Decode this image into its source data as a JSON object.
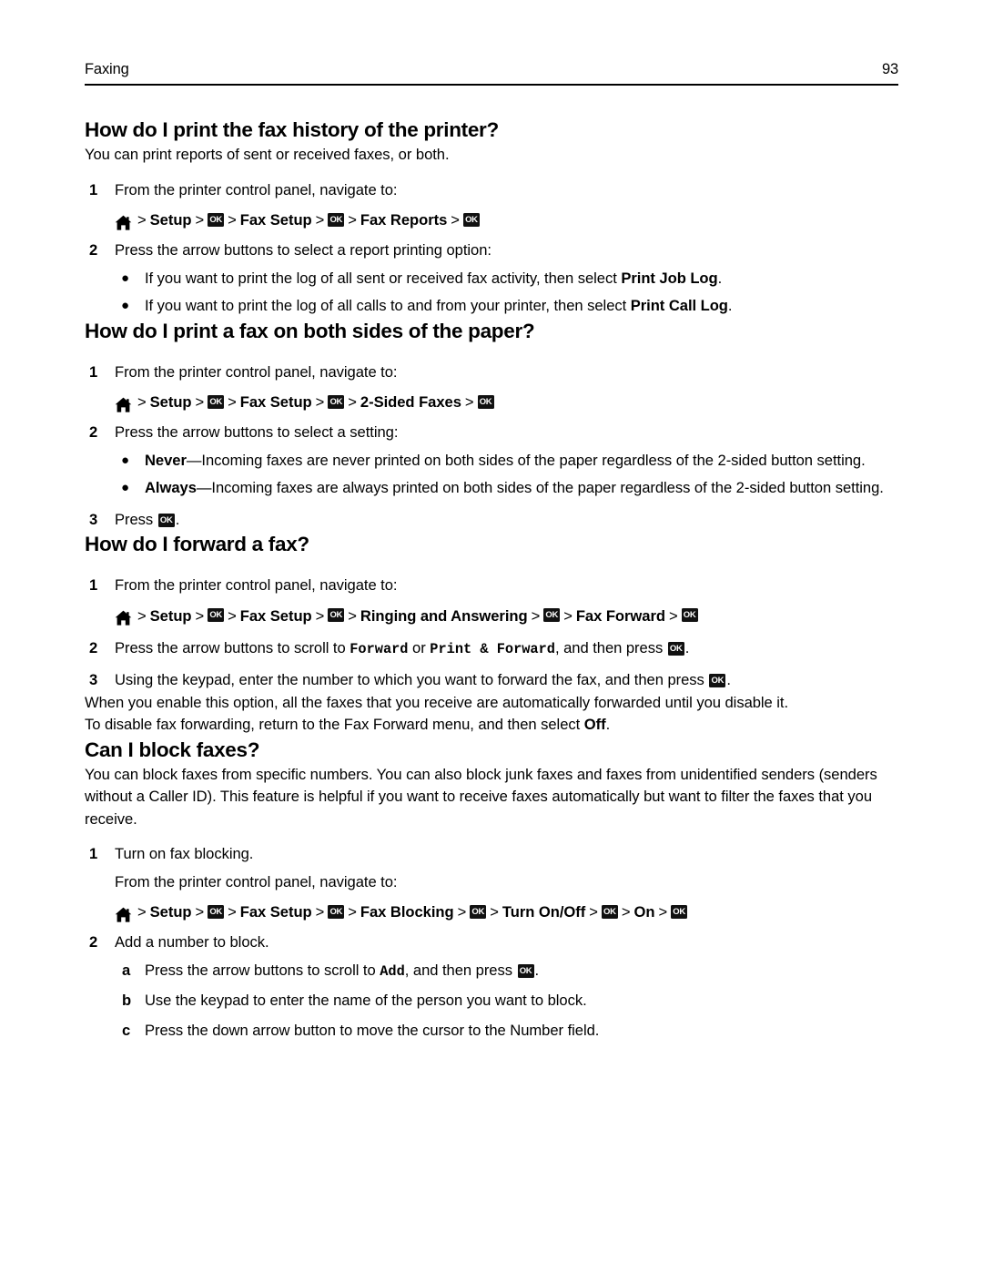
{
  "header": {
    "chapter": "Faxing",
    "page_number": "93"
  },
  "icons": {
    "home": "home-icon",
    "ok": "OK"
  },
  "sections": [
    {
      "title": "How do I print the fax history of the printer?",
      "intro": "You can print reports of sent or received faxes, or both.",
      "step1_num": "1",
      "step1_text": "From the printer control panel, navigate to:",
      "navpath": [
        "Setup",
        "Fax Setup",
        "Fax Reports"
      ],
      "step2_num": "2",
      "step2_text": "Press the arrow buttons to select a report printing option:",
      "bullets": [
        {
          "pre": "If you want to print the log of all sent or received fax activity, then select ",
          "bold": "Print Job Log",
          "post": "."
        },
        {
          "pre": "If you want to print the log of all calls to and from your printer, then select ",
          "bold": "Print Call Log",
          "post": "."
        }
      ]
    },
    {
      "title": "How do I print a fax on both sides of the paper?",
      "step1_num": "1",
      "step1_text": "From the printer control panel, navigate to:",
      "navpath": [
        "Setup",
        "Fax Setup",
        "2-Sided Faxes"
      ],
      "step2_num": "2",
      "step2_text": "Press the arrow buttons to select a setting:",
      "bullets": [
        {
          "bold": "Never",
          "post": "—Incoming faxes are never printed on both sides of the paper regardless of the 2-sided button setting."
        },
        {
          "bold": "Always",
          "post": "—Incoming faxes are always printed on both sides of the paper regardless of the 2-sided button setting."
        }
      ],
      "step3_num": "3",
      "step3_pre": "Press ",
      "step3_post": "."
    },
    {
      "title": "How do I forward a fax?",
      "step1_num": "1",
      "step1_text": "From the printer control panel, navigate to:",
      "navpath": [
        "Setup",
        "Fax Setup",
        "Ringing and Answering",
        "Fax Forward"
      ],
      "step2_num": "2",
      "step2_pre": "Press the arrow buttons to scroll to ",
      "step2_mono1": "Forward",
      "step2_mid": " or ",
      "step2_mono2": "Print & Forward",
      "step2_post": ", and then press ",
      "step2_end": ".",
      "step3_num": "3",
      "step3_pre": "Using the keypad, enter the number to which you want to forward the fax, and then press ",
      "step3_end": ".",
      "para1": "When you enable this option, all the faxes that you receive are automatically forwarded until you disable it.",
      "para2_pre": "To disable fax forwarding, return to the Fax Forward menu, and then select ",
      "para2_bold": "Off",
      "para2_post": "."
    },
    {
      "title": "Can I block faxes?",
      "intro": "You can block faxes from specific numbers. You can also block junk faxes and faxes from unidentified senders (senders without a Caller ID). This feature is helpful if you want to receive faxes automatically but want to filter the faxes that you receive.",
      "step1_num": "1",
      "step1_text": "Turn on fax blocking.",
      "step1_sub": "From the printer control panel, navigate to:",
      "navpath": [
        "Setup",
        "Fax Setup",
        "Fax Blocking",
        "Turn On/Off",
        "On"
      ],
      "step2_num": "2",
      "step2_text": "Add a number to block.",
      "substeps": [
        {
          "num": "a",
          "pre": "Press the arrow buttons to scroll to ",
          "mono": "Add",
          "post": ", and then press ",
          "end": "."
        },
        {
          "num": "b",
          "pre": "Use the keypad to enter the name of the person you want to block."
        },
        {
          "num": "c",
          "pre": "Press the down arrow button to move the cursor to the Number field."
        }
      ]
    }
  ]
}
